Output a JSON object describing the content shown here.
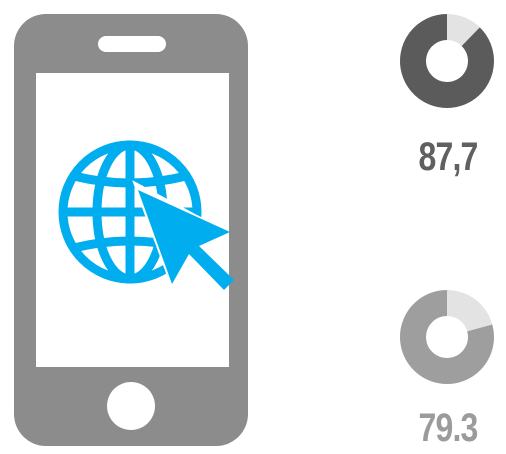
{
  "colors": {
    "phone_body": "#8c8c8c",
    "phone_screen": "#ffffff",
    "icon_accent": "#00adef",
    "track": "#e3e3e3"
  },
  "icons": {
    "device": "smartphone-icon",
    "screen": "globe-with-cursor-icon",
    "home": "home-button-icon",
    "speaker": "speaker-slot-icon"
  },
  "chart_data": [
    {
      "type": "pie",
      "values": [
        87.7,
        12.3
      ],
      "label": "87,7",
      "value_color": "#5b5b5b",
      "track_color": "#e3e3e3",
      "label_color": "#606060"
    },
    {
      "type": "pie",
      "values": [
        79.3,
        20.7
      ],
      "label": "79.3",
      "value_color": "#9e9e9e",
      "track_color": "#e3e3e3",
      "label_color": "#9b9b9b"
    }
  ]
}
